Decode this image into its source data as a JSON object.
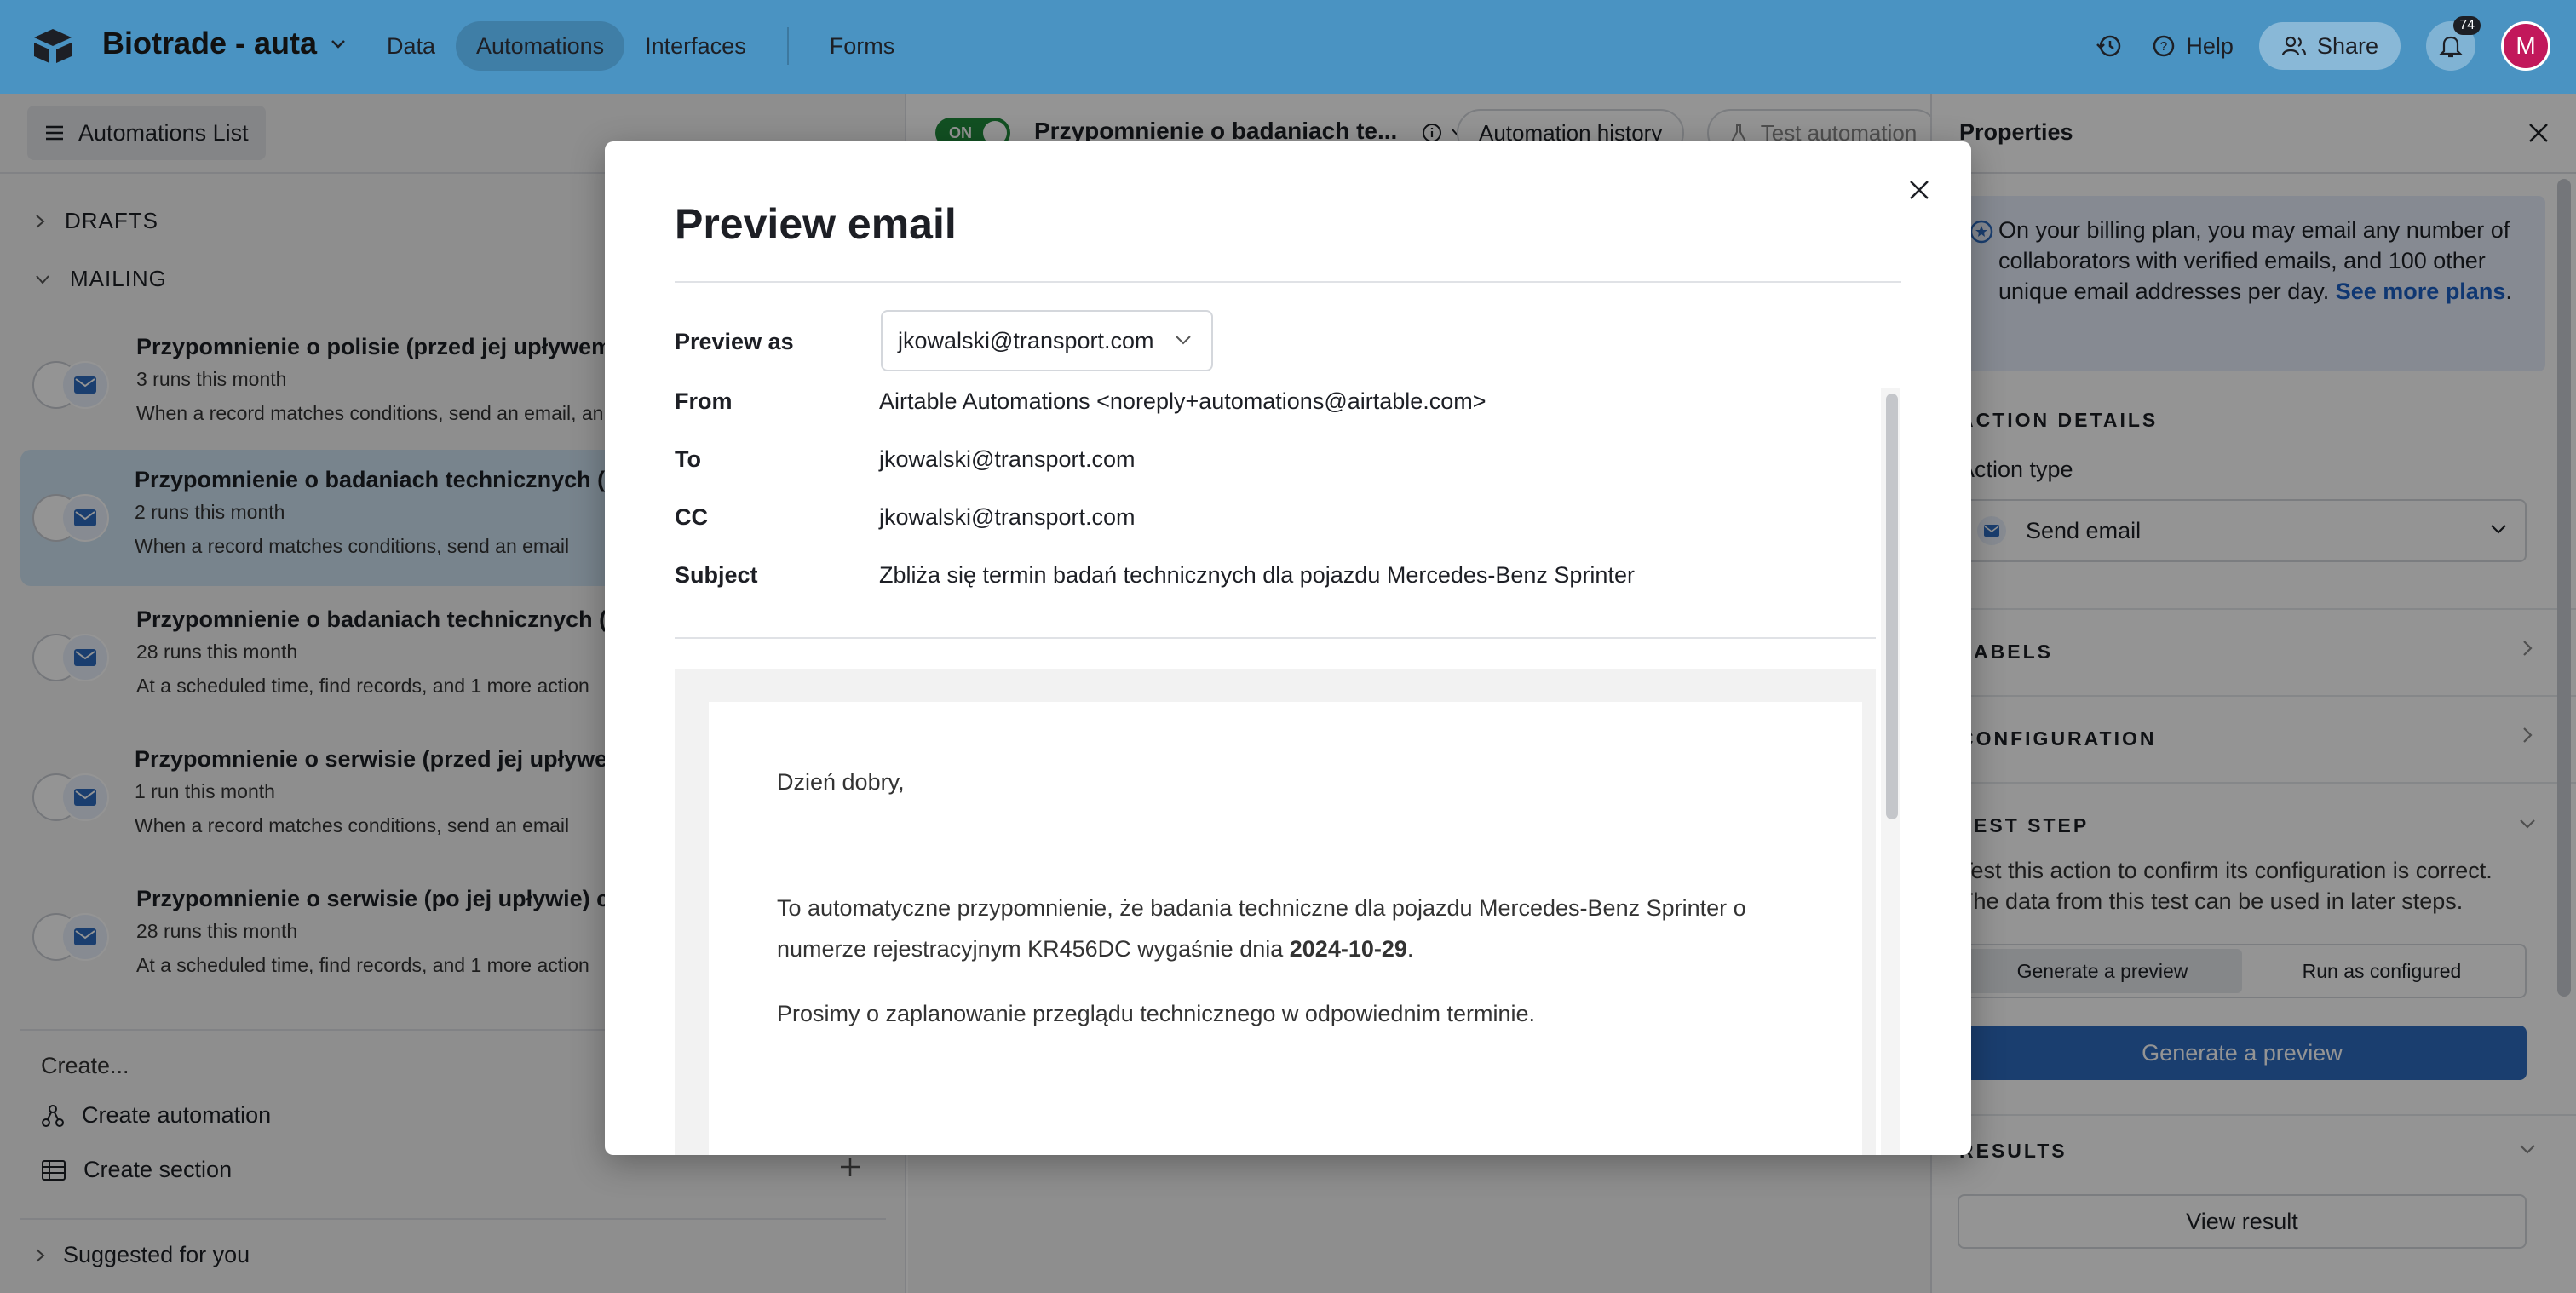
{
  "topbar": {
    "base_name": "Biotrade - auta",
    "nav": [
      "Data",
      "Automations",
      "Interfaces",
      "Forms"
    ],
    "help": "Help",
    "share": "Share",
    "notif_count": "74",
    "avatar": "M"
  },
  "left": {
    "list_button": "Automations List",
    "drafts": "DRAFTS",
    "mailing": "MAILING",
    "automations": [
      {
        "title": "Przypomnienie o polisie (przed jej upływem)",
        "runs": "3 runs this month",
        "desc": "When a record matches conditions, send an email, an"
      },
      {
        "title": "Przypomnienie o badaniach technicznych (pr",
        "runs": "2 runs this month",
        "desc": "When a record matches conditions, send an email"
      },
      {
        "title": "Przypomnienie o badaniach technicznych (po",
        "runs": "28 runs this month",
        "desc": "At a scheduled time, find records, and 1 more action"
      },
      {
        "title": "Przypomnienie o serwisie (przed jej upływem",
        "runs": "1 run this month",
        "desc": "When a record matches conditions, send an email"
      },
      {
        "title": "Przypomnienie o serwisie (po jej upływie) co",
        "runs": "28 runs this month",
        "desc": "At a scheduled time, find records, and 1 more action"
      }
    ],
    "create_label": "Create...",
    "create_automation": "Create automation",
    "create_section": "Create section",
    "suggested": "Suggested for you"
  },
  "middle": {
    "toggle": "ON",
    "title": "Przypomnienie o badaniach te...",
    "history": "Automation history",
    "test": "Test automation"
  },
  "properties": {
    "header": "Properties",
    "info_text": "On your billing plan, you may email any number of collaborators with verified emails, and 100 other unique email addresses per day.",
    "info_link": "See more plans",
    "info_end": ".",
    "action_details": "ACTION DETAILS",
    "action_type_label": "Action type",
    "action_type_value": "Send email",
    "labels": "LABELS",
    "configuration": "CONFIGURATION",
    "test_step": "TEST STEP",
    "test_desc": "Test this action to confirm its configuration is correct. The data from this test can be used in later steps.",
    "seg_preview": "Generate a preview",
    "seg_run": "Run as configured",
    "generate_btn": "Generate a preview",
    "results": "RESULTS",
    "view_result": "View result"
  },
  "modal": {
    "title": "Preview email",
    "preview_as_label": "Preview as",
    "preview_as_value": "jkowalski@transport.com",
    "from_label": "From",
    "from_value": "Airtable Automations <noreply+automations@airtable.com>",
    "to_label": "To",
    "to_value": "jkowalski@transport.com",
    "cc_label": "CC",
    "cc_value": "jkowalski@transport.com",
    "subject_label": "Subject",
    "subject_value": "Zbliża się termin badań technicznych dla pojazdu Mercedes-Benz Sprinter",
    "body_greeting": "Dzień dobry,",
    "body_p1_a": "To automatyczne przypomnienie, że badania techniczne dla pojazdu Mercedes-Benz Sprinter o numerze rejestracyjnym KR456DC wygaśnie dnia ",
    "body_p1_date": "2024-10-29",
    "body_p1_b": ".",
    "body_p2": "Prosimy o zaplanowanie przeglądu technicznego w odpowiednim terminie."
  }
}
